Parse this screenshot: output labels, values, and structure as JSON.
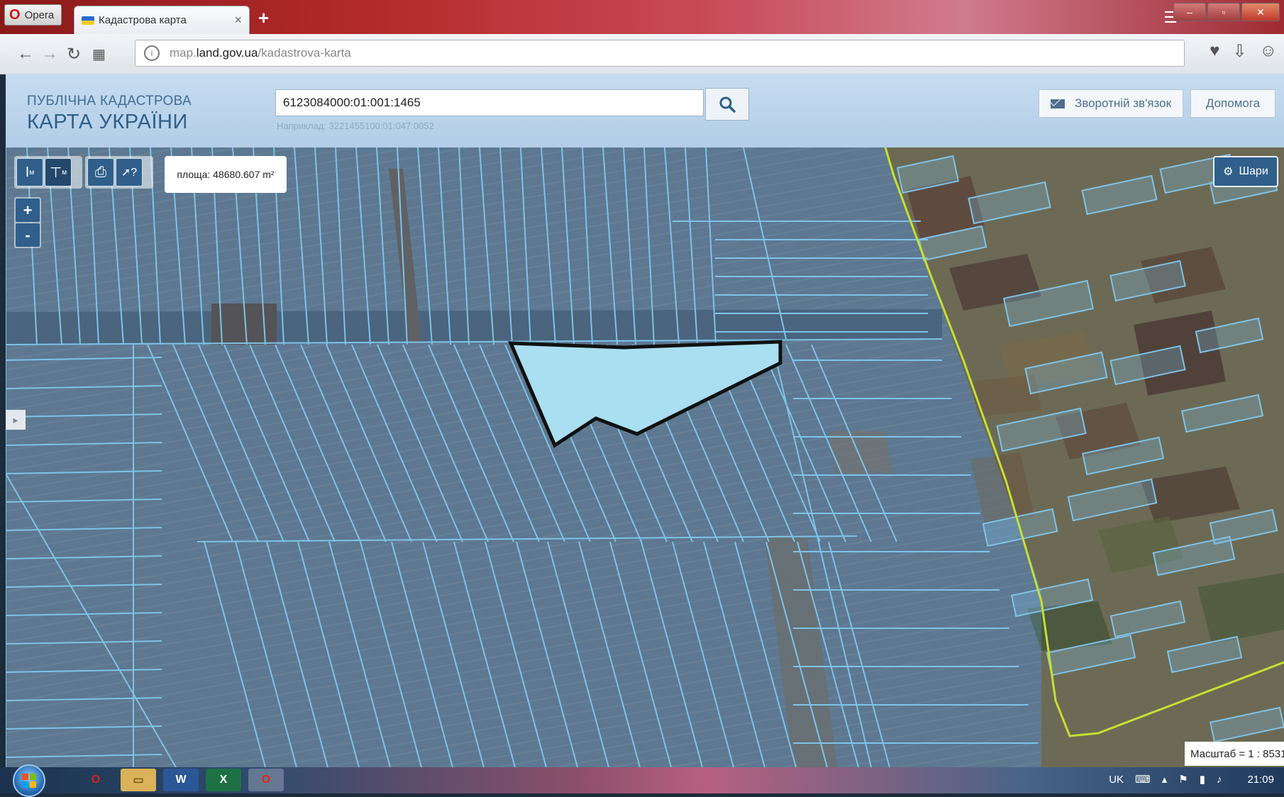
{
  "browser": {
    "menu_label": "Opera",
    "tab_title": "Кадастрова карта",
    "tab_close": "×",
    "new_tab": "+",
    "url_host_prefix": "map.",
    "url_host": "land.gov.ua",
    "url_path": "/kadastrova-karta"
  },
  "header": {
    "brand_line1": "ПУБЛІЧНА КАДАСТРОВА",
    "brand_line2": "КАРТА УКРАЇНИ",
    "search_value": "6123084000:01:001:1465",
    "search_hint": "Наприклад: 3221455100:01:047:0052",
    "feedback_label": "Зворотній зв'язок",
    "help_label": "Допомога"
  },
  "map": {
    "area_label": "площа: 48680.607 m²",
    "zoom_in": "+",
    "zoom_out": "-",
    "layers_label": "Шари",
    "scale_label": "Масштаб = 1 : 8531",
    "selected_parcel_color": "#a9dff0",
    "parcel_line_color": "#7ec3e8",
    "boundary_color": "#c6e032"
  },
  "taskbar": {
    "lang": "UK",
    "clock": "21:09",
    "apps": [
      "opera",
      "explorer",
      "word",
      "excel",
      "opera-active"
    ]
  }
}
